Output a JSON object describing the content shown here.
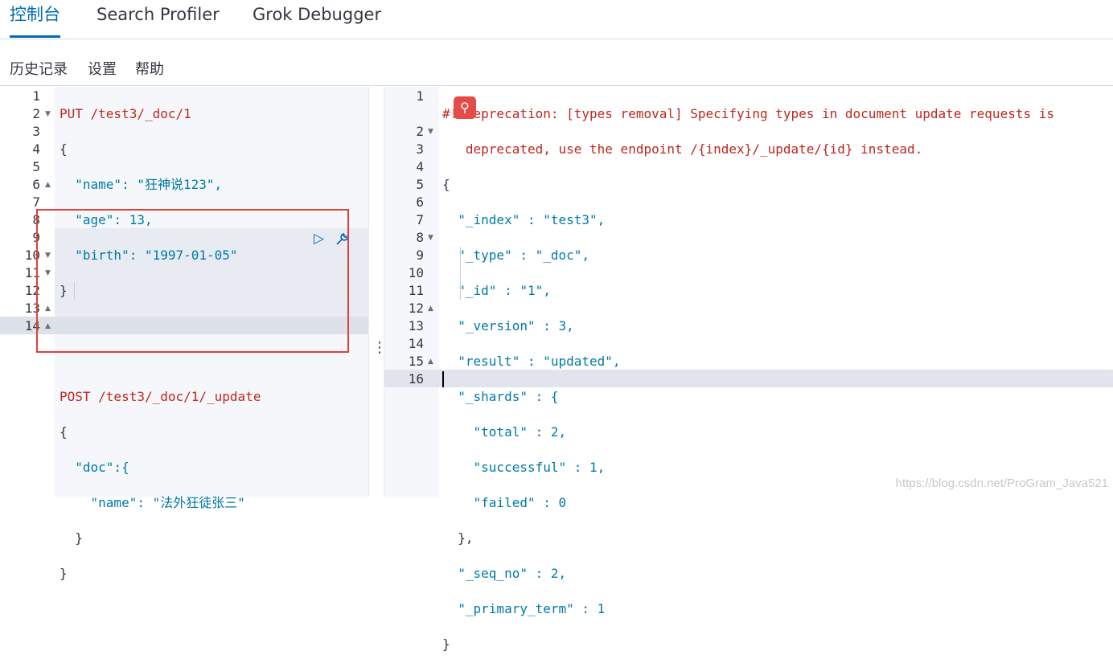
{
  "tabs": [
    {
      "label": "控制台",
      "active": true
    },
    {
      "label": "Search Profiler",
      "active": false
    },
    {
      "label": "Grok Debugger",
      "active": false
    }
  ],
  "menu": {
    "history": "历史记录",
    "settings": "设置",
    "help": "帮助"
  },
  "request_lines": [
    {
      "no": "1",
      "text": "PUT /test3/_doc/1"
    },
    {
      "no": "2",
      "text": "{"
    },
    {
      "no": "3",
      "text": "  \"name\": \"狂神说123\","
    },
    {
      "no": "4",
      "text": "  \"age\": 13,"
    },
    {
      "no": "5",
      "text": "  \"birth\": \"1997-01-05\""
    },
    {
      "no": "6",
      "text": "}"
    },
    {
      "no": "7",
      "text": ""
    },
    {
      "no": "8",
      "text": ""
    },
    {
      "no": "9",
      "text": "POST /test3/_doc/1/_update"
    },
    {
      "no": "10",
      "text": "{"
    },
    {
      "no": "11",
      "text": "  \"doc\":{"
    },
    {
      "no": "12",
      "text": "    \"name\": \"法外狂徒张三\""
    },
    {
      "no": "13",
      "text": "  }"
    },
    {
      "no": "14",
      "text": "}"
    }
  ],
  "response_lines": [
    {
      "no": "1",
      "text": "#! Deprecation: [types removal] Specifying types in document update requests is"
    },
    {
      "no": "",
      "text": "   deprecated, use the endpoint /{index}/_update/{id} instead."
    },
    {
      "no": "2",
      "text": "{"
    },
    {
      "no": "3",
      "text": "  \"_index\" : \"test3\","
    },
    {
      "no": "4",
      "text": "  \"_type\" : \"_doc\","
    },
    {
      "no": "5",
      "text": "  \"_id\" : \"1\","
    },
    {
      "no": "6",
      "text": "  \"_version\" : 3,"
    },
    {
      "no": "7",
      "text": "  \"result\" : \"updated\","
    },
    {
      "no": "8",
      "text": "  \"_shards\" : {"
    },
    {
      "no": "9",
      "text": "    \"total\" : 2,"
    },
    {
      "no": "10",
      "text": "    \"successful\" : 1,"
    },
    {
      "no": "11",
      "text": "    \"failed\" : 0"
    },
    {
      "no": "12",
      "text": "  },"
    },
    {
      "no": "13",
      "text": "  \"_seq_no\" : 2,"
    },
    {
      "no": "14",
      "text": "  \"_primary_term\" : 1"
    },
    {
      "no": "15",
      "text": "}"
    },
    {
      "no": "16",
      "text": ""
    }
  ],
  "actions": {
    "run_icon": "play-icon",
    "wrench_icon": "wrench-icon"
  },
  "watermark": "https://blog.csdn.net/ProGram_Java521",
  "colors": {
    "accent": "#006bb4",
    "method": "#bd271e",
    "key": "#0079a5",
    "string": "#017d73",
    "highlight_box": "#e0413a"
  }
}
